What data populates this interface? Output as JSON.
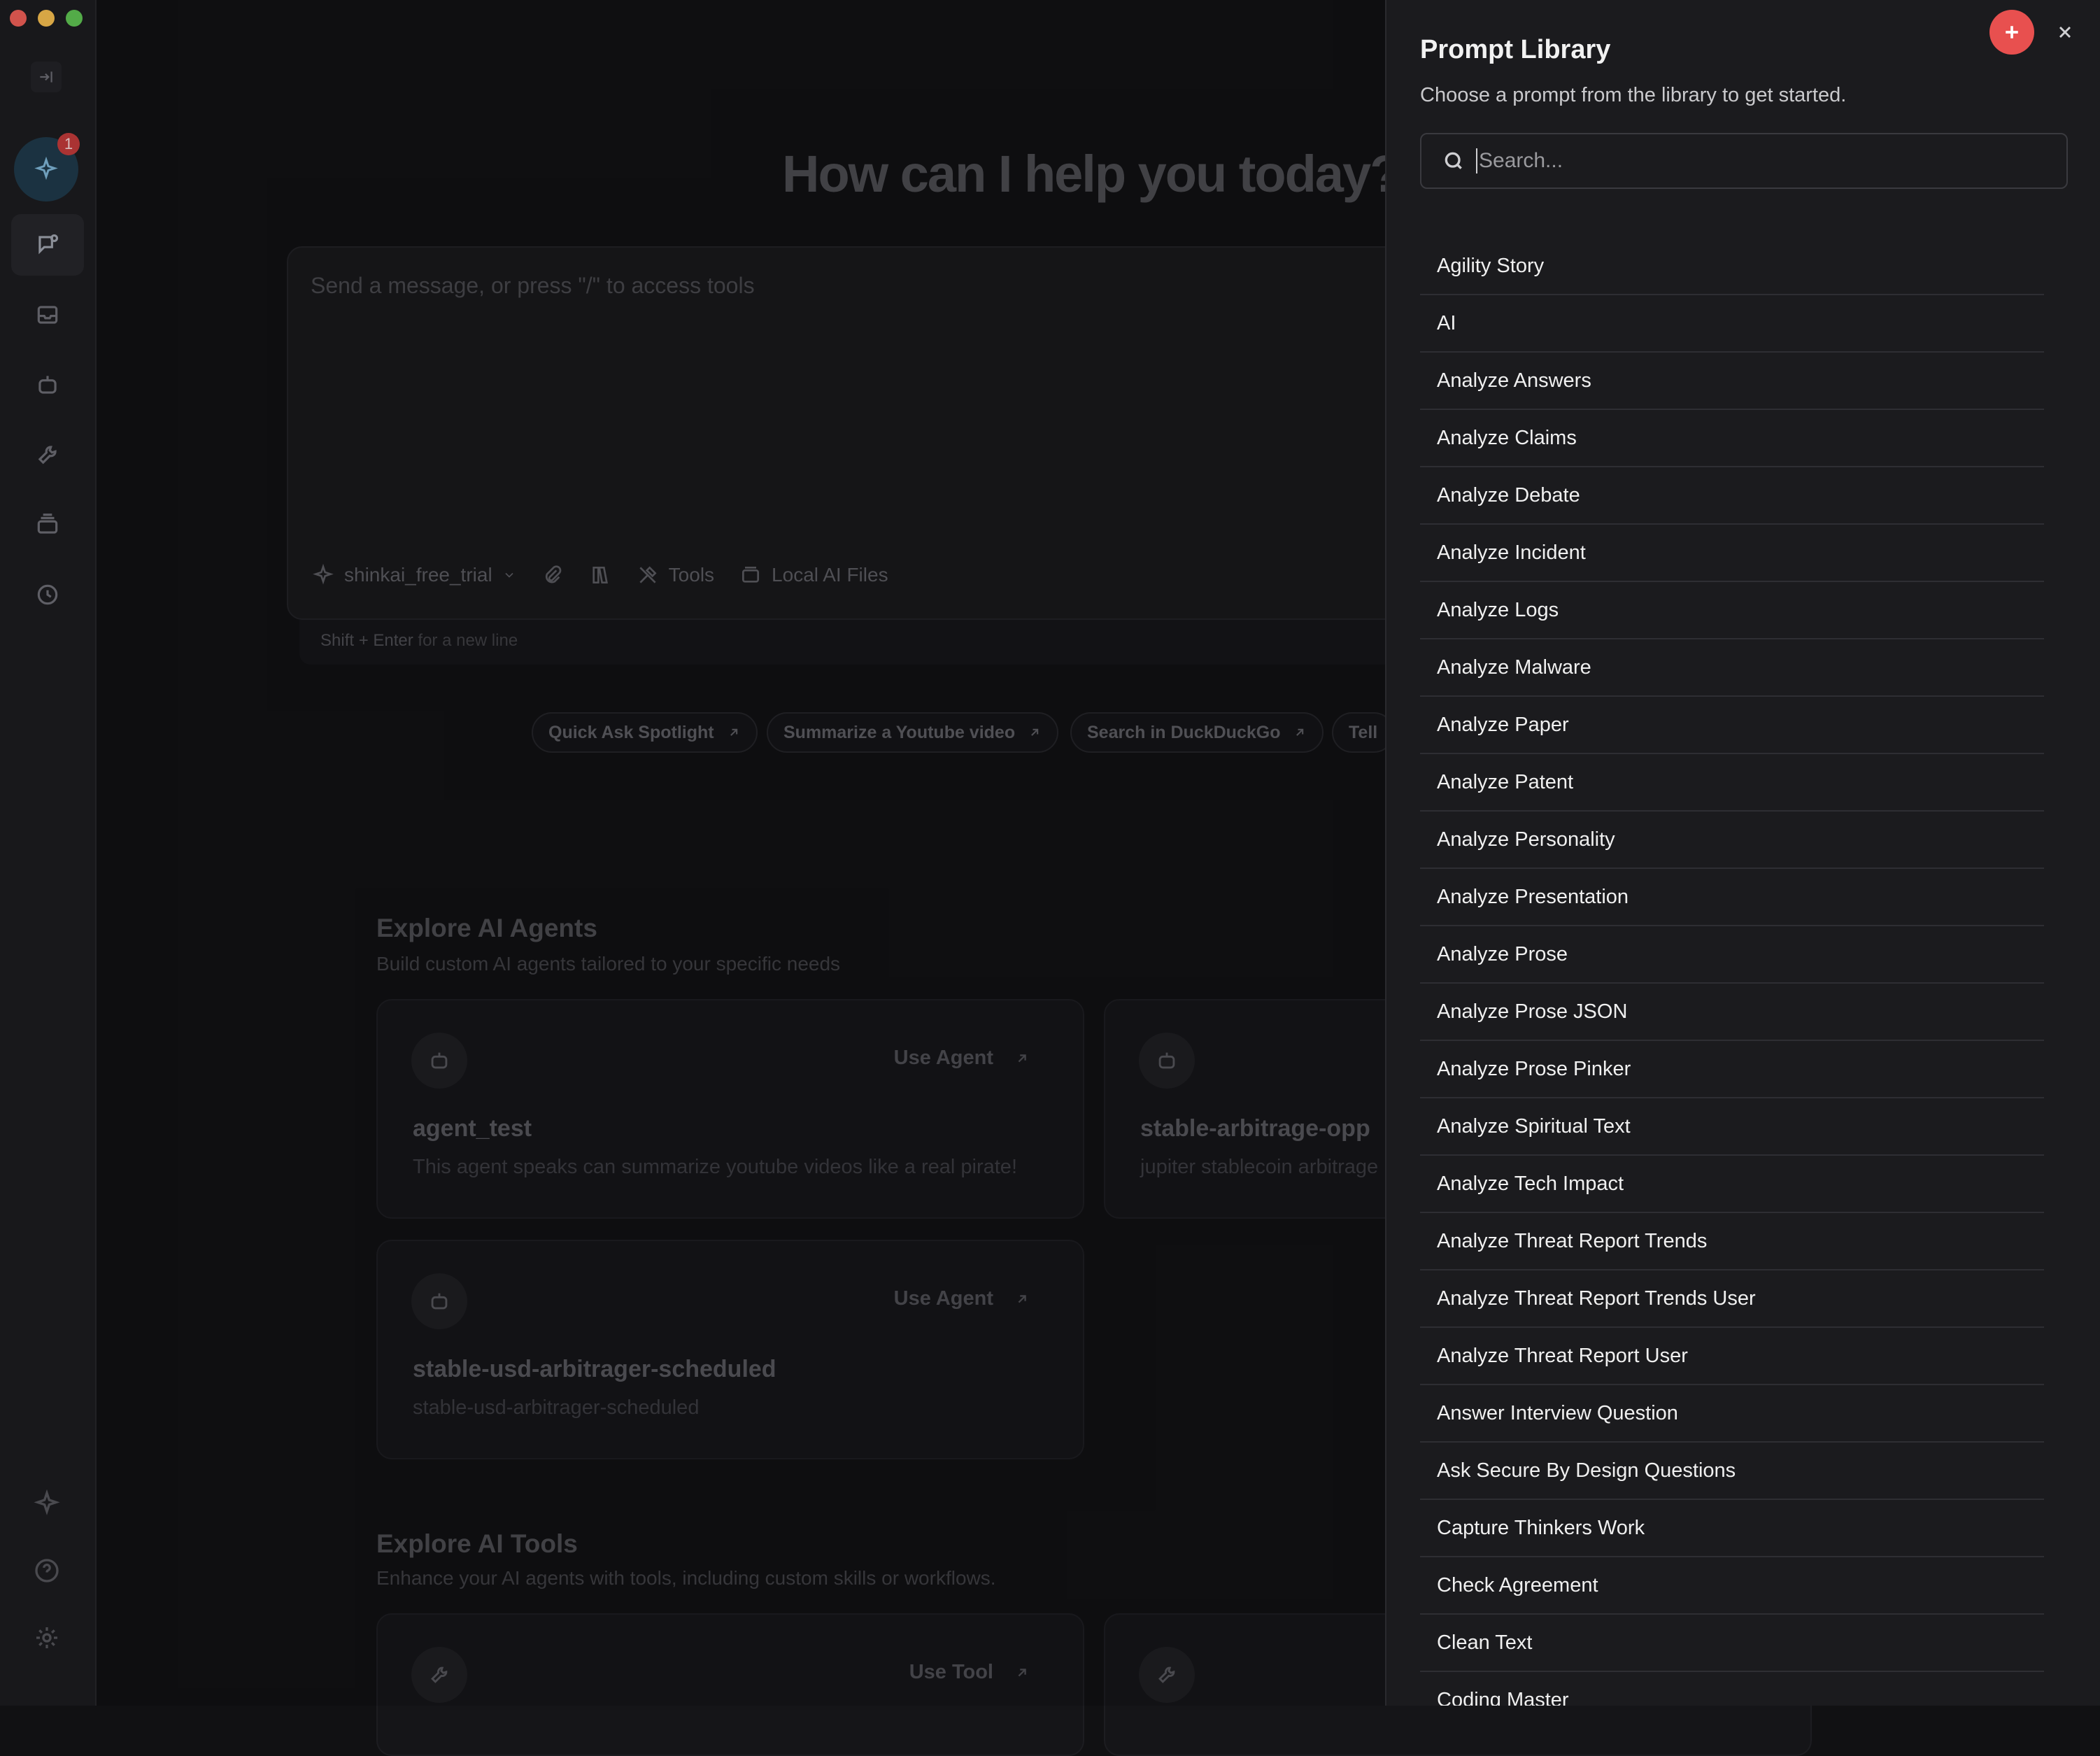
{
  "sidebar": {
    "notification_count": "1"
  },
  "main": {
    "hero_title": "How can I help you today?",
    "composer": {
      "placeholder": "Send a message, or press \"/\" to access tools",
      "model": "shinkai_free_trial",
      "tools_label": "Tools",
      "local_files_label": "Local AI Files",
      "hint_keys": "Shift + Enter",
      "hint_text": " for a new line"
    },
    "chips": [
      "Quick Ask Spotlight",
      "Summarize a Youtube video",
      "Search in DuckDuckGo",
      "Tell"
    ],
    "agents_section": {
      "title": "Explore AI Agents",
      "subtitle": "Build custom AI agents tailored to your specific needs",
      "action_label": "Use Agent",
      "cards": [
        {
          "title": "agent_test",
          "description": "This agent speaks can summarize youtube videos like a real pirate!"
        },
        {
          "title": "stable-arbitrage-opp",
          "description": "jupiter stablecoin arbitrage"
        },
        {
          "title": "stable-usd-arbitrager-scheduled",
          "description": "stable-usd-arbitrager-scheduled"
        }
      ]
    },
    "tools_section": {
      "title": "Explore AI Tools",
      "subtitle": "Enhance your AI agents with tools, including custom skills or workflows.",
      "action_label": "Use Tool"
    }
  },
  "drawer": {
    "title": "Prompt Library",
    "subtitle": "Choose a prompt from the library to get started.",
    "search_placeholder": "Search...",
    "prompts": [
      "Agility Story",
      "AI",
      "Analyze Answers",
      "Analyze Claims",
      "Analyze Debate",
      "Analyze Incident",
      "Analyze Logs",
      "Analyze Malware",
      "Analyze Paper",
      "Analyze Patent",
      "Analyze Personality",
      "Analyze Presentation",
      "Analyze Prose",
      "Analyze Prose JSON",
      "Analyze Prose Pinker",
      "Analyze Spiritual Text",
      "Analyze Tech Impact",
      "Analyze Threat Report Trends",
      "Analyze Threat Report Trends User",
      "Analyze Threat Report User",
      "Answer Interview Question",
      "Ask Secure By Design Questions",
      "Capture Thinkers Work",
      "Check Agreement",
      "Clean Text",
      "Coding Master"
    ]
  },
  "colors": {
    "accent_add": "#e8504f",
    "badge": "#c23b3b",
    "drawer_bg": "#1b1b1e",
    "app_bg": "#111113"
  }
}
